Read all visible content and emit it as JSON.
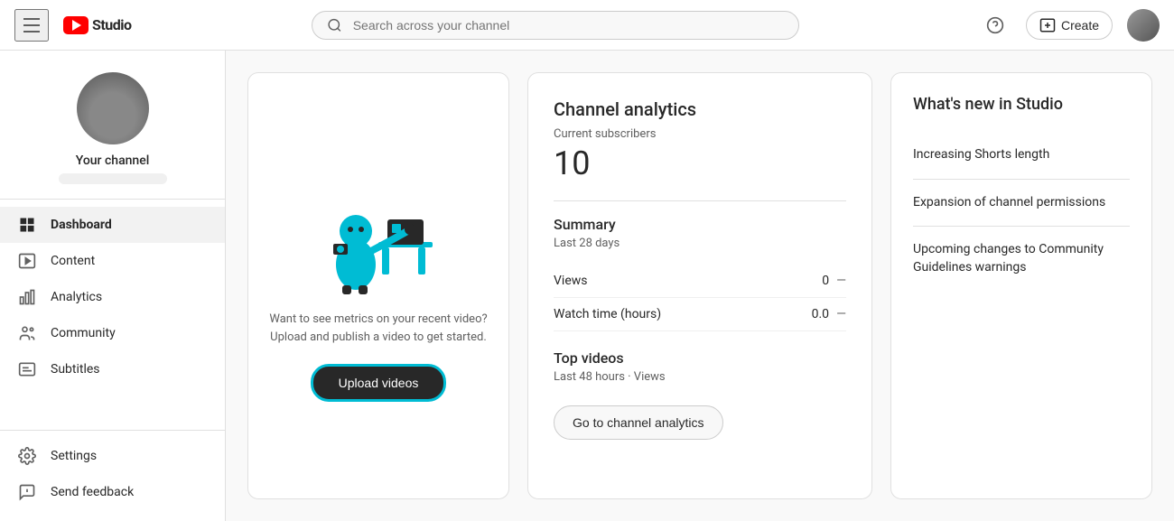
{
  "header": {
    "hamburger_label": "Menu",
    "logo_yt": "YouTube",
    "logo_studio": "Studio",
    "search_placeholder": "Search across your channel",
    "help_icon": "?",
    "create_label": "Create",
    "avatar_alt": "User avatar"
  },
  "sidebar": {
    "channel_name": "Your channel",
    "channel_btn": "",
    "nav_items": [
      {
        "id": "dashboard",
        "label": "Dashboard",
        "icon": "grid"
      },
      {
        "id": "content",
        "label": "Content",
        "icon": "play"
      },
      {
        "id": "analytics",
        "label": "Analytics",
        "icon": "bar-chart"
      },
      {
        "id": "community",
        "label": "Community",
        "icon": "people"
      },
      {
        "id": "subtitles",
        "label": "Subtitles",
        "icon": "subtitles"
      }
    ],
    "bottom_items": [
      {
        "id": "settings",
        "label": "Settings",
        "icon": "gear"
      },
      {
        "id": "send-feedback",
        "label": "Send feedback",
        "icon": "feedback"
      }
    ]
  },
  "upload_card": {
    "text": "Want to see metrics on your recent video? Upload and publish a video to get started.",
    "btn_label": "Upload videos"
  },
  "analytics_card": {
    "title": "Channel analytics",
    "subscribers_label": "Current subscribers",
    "subscribers_count": "10",
    "summary_title": "Summary",
    "summary_subtitle": "Last 28 days",
    "stats": [
      {
        "label": "Views",
        "value": "0",
        "change": "—"
      },
      {
        "label": "Watch time (hours)",
        "value": "0.0",
        "change": "—"
      }
    ],
    "top_videos_title": "Top videos",
    "top_videos_subtitle": "Last 48 hours · Views",
    "go_analytics_btn": "Go to channel analytics"
  },
  "whats_new_card": {
    "title": "What's new in Studio",
    "items": [
      {
        "label": "Increasing Shorts length"
      },
      {
        "label": "Expansion of channel permissions"
      },
      {
        "label": "Upcoming changes to Community Guidelines warnings"
      }
    ]
  }
}
